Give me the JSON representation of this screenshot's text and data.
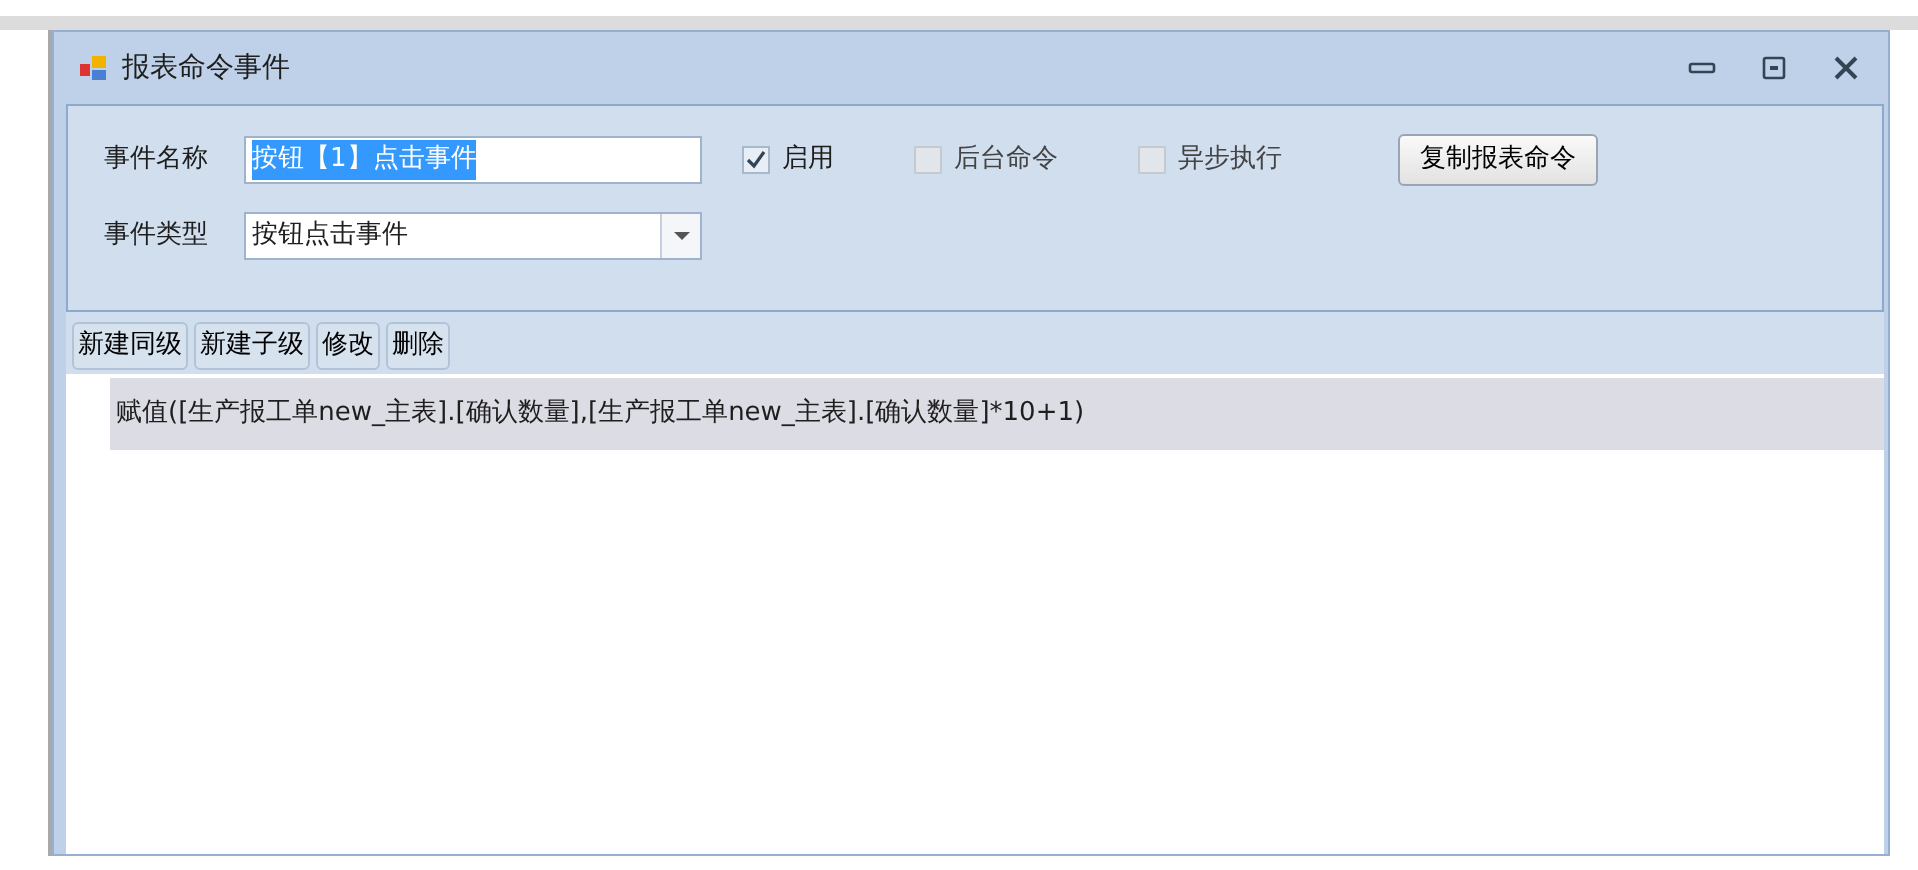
{
  "window": {
    "title": "报表命令事件"
  },
  "form": {
    "name_label": "事件名称",
    "name_value": "按钮【1】点击事件",
    "name_text_selected": true,
    "checkboxes": [
      {
        "label": "启用",
        "checked": true,
        "disabled": false
      },
      {
        "label": "后台命令",
        "checked": false,
        "disabled": true
      },
      {
        "label": "异步执行",
        "checked": false,
        "disabled": true
      }
    ],
    "copy_button": "复制报表命令",
    "type_label": "事件类型",
    "type_value": "按钮点击事件"
  },
  "toolbar": [
    "新建同级",
    "新建子级",
    "修改",
    "删除"
  ],
  "commands": [
    {
      "text": "赋值([生产报工单new_主表].[确认数量],[生产报工单new_主表].[确认数量]*10+1)",
      "selected": true
    }
  ]
}
